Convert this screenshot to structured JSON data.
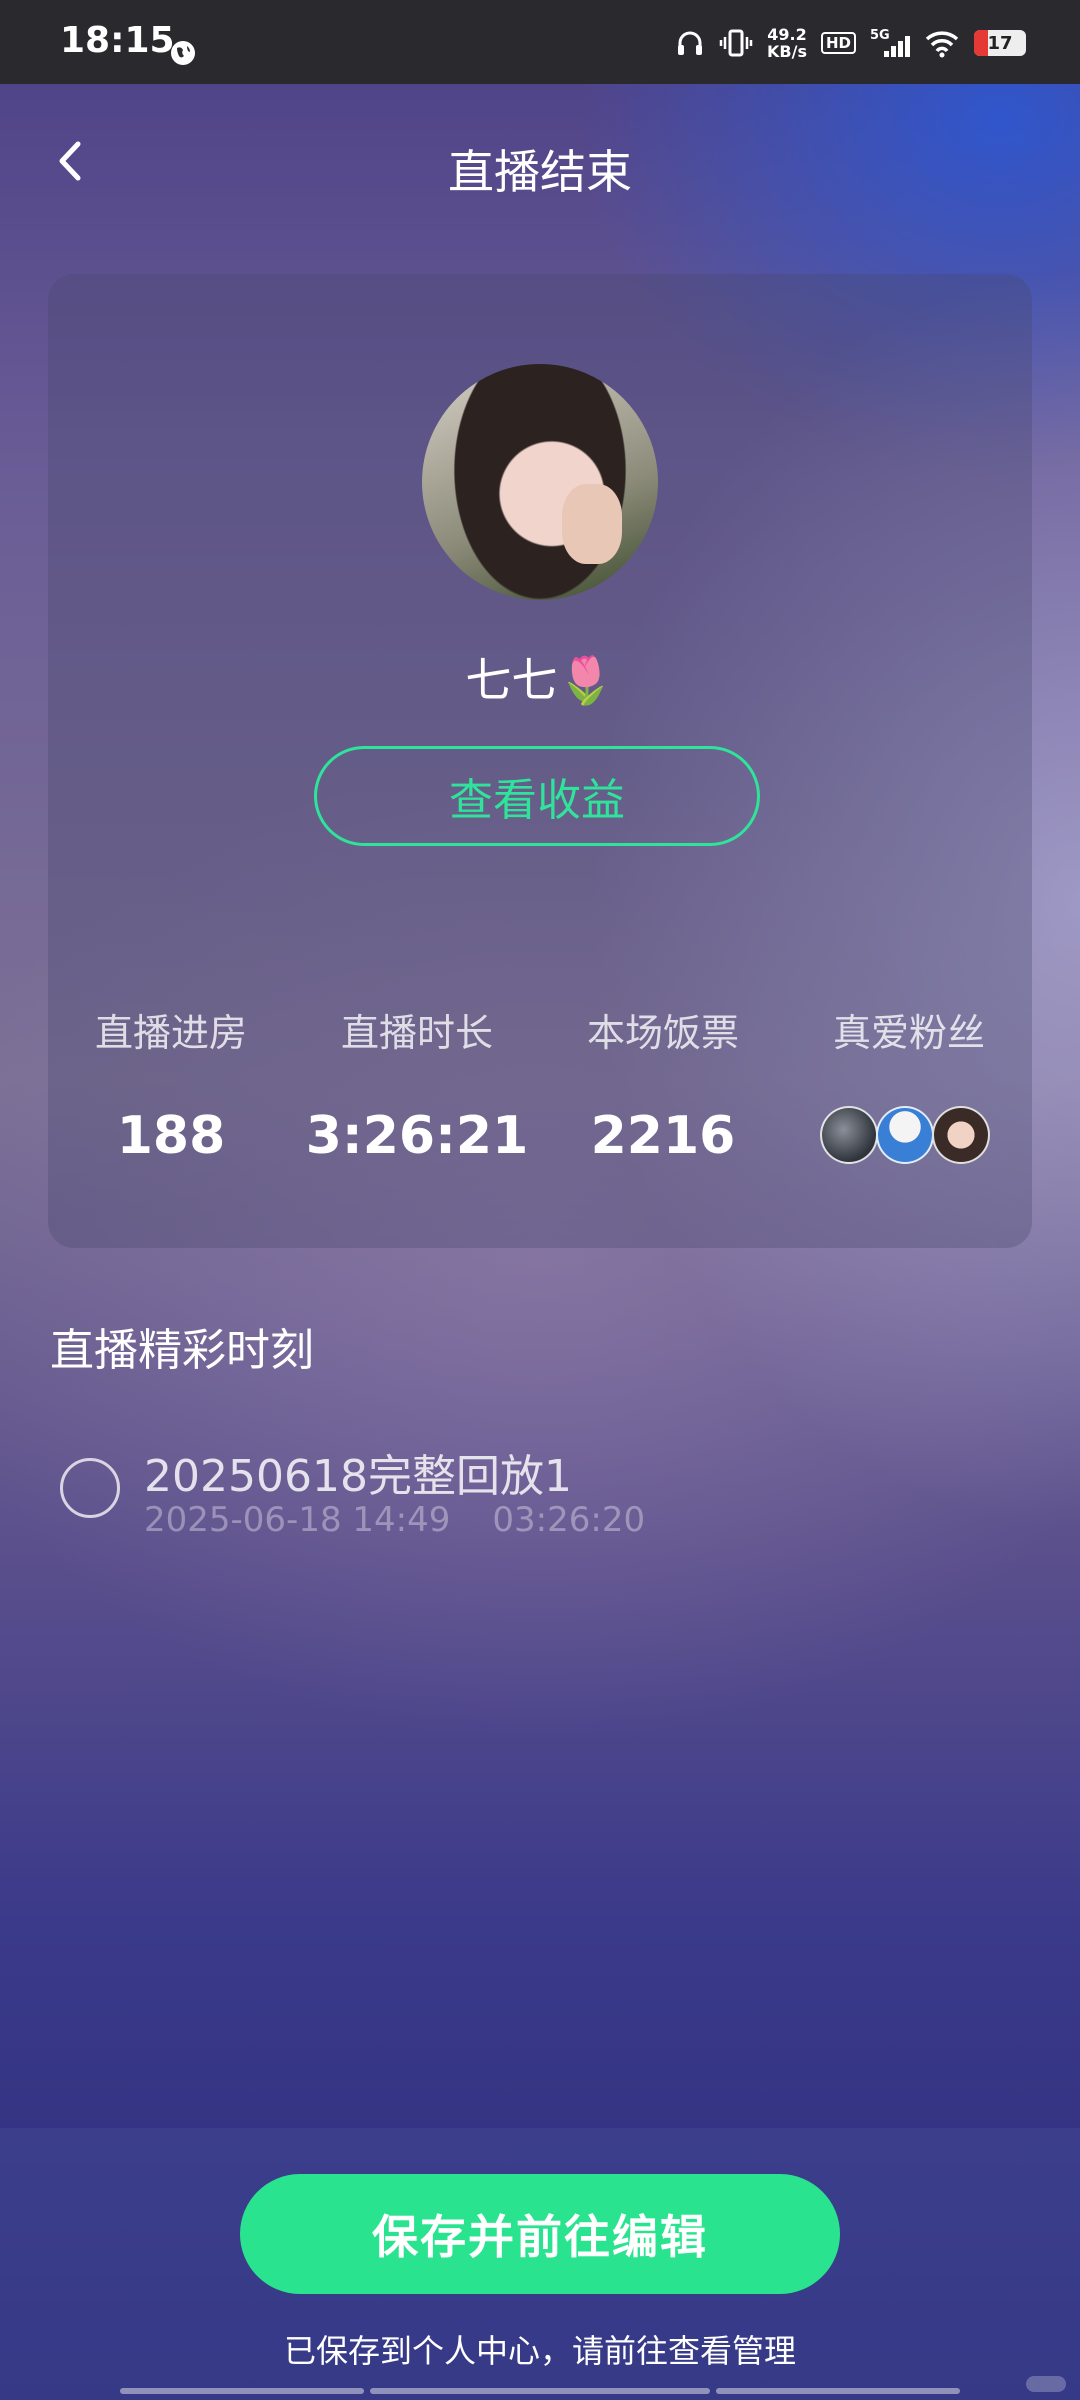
{
  "status_bar": {
    "time": "18:15",
    "net_speed_value": "49.2",
    "net_speed_unit": "KB/s",
    "hd_label": "HD",
    "network": "5G",
    "battery": "17",
    "icons": [
      "globe-icon",
      "headphones-icon",
      "vibrate-icon",
      "signal-icon",
      "wifi-icon",
      "battery-icon"
    ]
  },
  "header": {
    "title": "直播结束"
  },
  "summary_card": {
    "streamer_name": "七七🌷",
    "earnings_button": "查看收益",
    "stats": [
      {
        "label": "直播进房",
        "value": "188"
      },
      {
        "label": "直播时长",
        "value": "3:26:21"
      },
      {
        "label": "本场饭票",
        "value": "2216"
      },
      {
        "label": "真爱粉丝",
        "value": ""
      }
    ],
    "fan_avatar_count": 3
  },
  "highlights": {
    "title": "直播精彩时刻",
    "items": [
      {
        "title": "20250618完整回放1",
        "date": "2025-06-18 14:49",
        "duration": "03:26:20"
      }
    ]
  },
  "footer": {
    "save_button": "保存并前往编辑",
    "note": "已保存到个人中心，请前往查看管理"
  },
  "colors": {
    "accent_green": "#29e38f",
    "outline_green": "#2fe39a"
  }
}
